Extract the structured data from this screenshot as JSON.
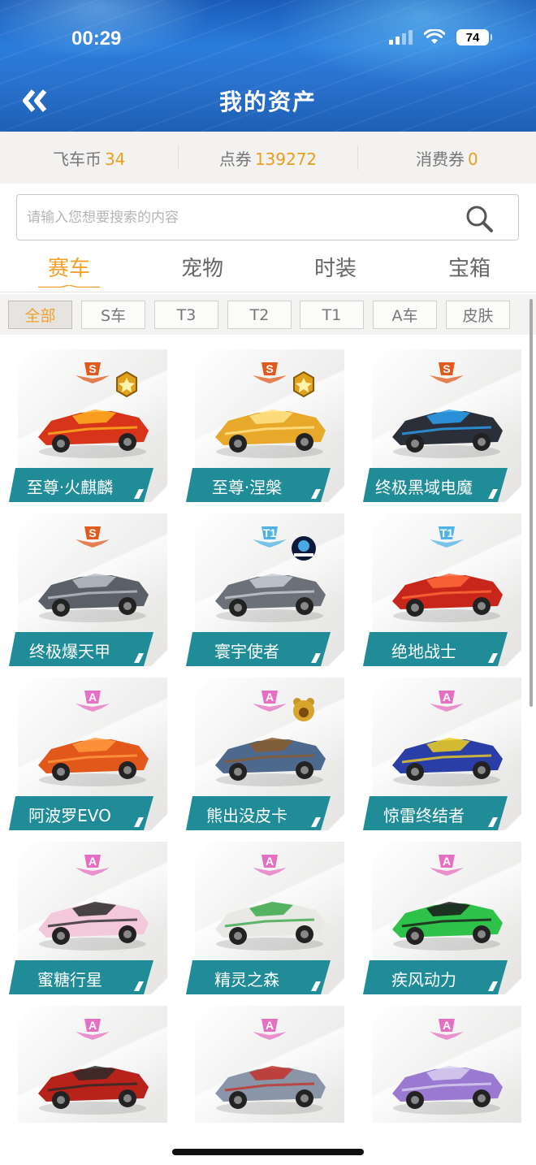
{
  "status_bar": {
    "time": "00:29",
    "battery": "74"
  },
  "header": {
    "title": "我的资产"
  },
  "currencies": [
    {
      "label": "飞车币",
      "value": "34"
    },
    {
      "label": "点券",
      "value": "139272"
    },
    {
      "label": "消费券",
      "value": "0"
    }
  ],
  "search": {
    "placeholder": "请输入您想要搜索的内容"
  },
  "tabs": [
    {
      "label": "赛车"
    },
    {
      "label": "宠物"
    },
    {
      "label": "时装"
    },
    {
      "label": "宝箱"
    }
  ],
  "filters": [
    {
      "label": "全部"
    },
    {
      "label": "S车"
    },
    {
      "label": "T3"
    },
    {
      "label": "T2"
    },
    {
      "label": "T1"
    },
    {
      "label": "A车"
    },
    {
      "label": "皮肤"
    }
  ],
  "colors": {
    "accent": "#f2a12a",
    "banner": "#1f8c98",
    "s_rank": "#e05a1e",
    "t1_rank": "#4fb3e6",
    "a_rank": "#e56fc0"
  },
  "cars": [
    {
      "name": "至尊·火麒麟",
      "rank": "S",
      "extra": "gold-medal-icon",
      "color": "#d8341a",
      "accent": "#ffb020"
    },
    {
      "name": "至尊·涅槃",
      "rank": "S",
      "extra": "gold-medal-icon",
      "color": "#e8a92a",
      "accent": "#ffe48a"
    },
    {
      "name": "终极黑域电魔",
      "rank": "S",
      "extra": "",
      "color": "#2a2f3a",
      "accent": "#2aa0f0"
    },
    {
      "name": "终极爆天甲",
      "rank": "S",
      "extra": "",
      "color": "#5a5f68",
      "accent": "#b8c0c8"
    },
    {
      "name": "寰宇使者",
      "rank": "T1",
      "extra": "unitree-logo-icon",
      "color": "#6c7078",
      "accent": "#c9ced6"
    },
    {
      "name": "绝地战士",
      "rank": "T1",
      "extra": "",
      "color": "#c8261a",
      "accent": "#ff6a3a"
    },
    {
      "name": "阿波罗EVO",
      "rank": "A",
      "extra": "",
      "color": "#e2571a",
      "accent": "#ff9a40"
    },
    {
      "name": "熊出没皮卡",
      "rank": "A",
      "extra": "bear-medal-icon",
      "color": "#4d6a8e",
      "accent": "#8a5a2a"
    },
    {
      "name": "惊雷终结者",
      "rank": "A",
      "extra": "",
      "color": "#2a3ea8",
      "accent": "#f0d020"
    },
    {
      "name": "蜜糖行星",
      "rank": "A",
      "extra": "",
      "color": "#f2c8da",
      "accent": "#2a2a2a"
    },
    {
      "name": "精灵之森",
      "rank": "A",
      "extra": "",
      "color": "#e8e8e4",
      "accent": "#3aa84a"
    },
    {
      "name": "疾风动力",
      "rank": "A",
      "extra": "",
      "color": "#2fc24a",
      "accent": "#1a1a1a"
    },
    {
      "name": "",
      "rank": "A",
      "extra": "",
      "color": "#b8221a",
      "accent": "#2a2a2a"
    },
    {
      "name": "",
      "rank": "A",
      "extra": "",
      "color": "#8a96a8",
      "accent": "#c2322a"
    },
    {
      "name": "",
      "rank": "A",
      "extra": "",
      "color": "#9a7ad0",
      "accent": "#d8d0f0"
    }
  ]
}
